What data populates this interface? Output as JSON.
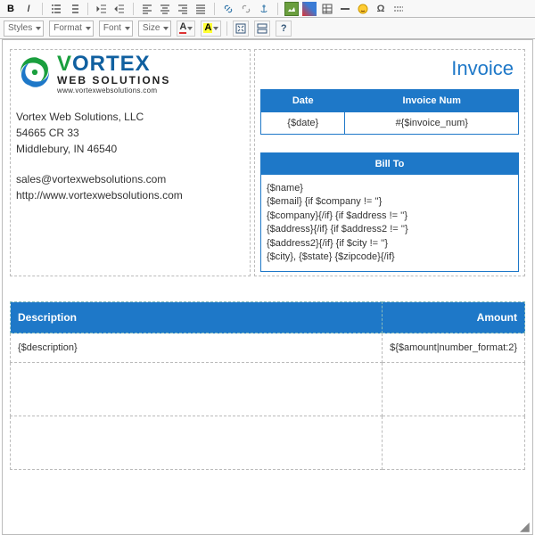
{
  "toolbar": {
    "styles_label": "Styles",
    "format_label": "Format",
    "font_label": "Font",
    "size_label": "Size"
  },
  "logo": {
    "brand_v": "V",
    "brand_rest": "ORTEX",
    "brand_sub": "WEB SOLUTIONS",
    "brand_url": "www.vortexwebsolutions.com"
  },
  "company": {
    "name": "Vortex Web Solutions, LLC",
    "addr1": "54665 CR 33",
    "addr2": "Middlebury, IN 46540",
    "email": "sales@vortexwebsolutions.com",
    "website": "http://www.vortexwebsolutions.com"
  },
  "invoice": {
    "title": "Invoice",
    "date_header": "Date",
    "num_header": "Invoice Num",
    "date_value": "{$date}",
    "num_value": "#{$invoice_num}"
  },
  "billto": {
    "header": "Bill To",
    "body": "{$name}\n{$email} {if $company != ''}\n{$company}{/if} {if $address != ''}\n{$address}{/if} {if $address2 != ''}\n{$address2}{/if} {if $city != ''}\n{$city}, {$state} {$zipcode}{/if}"
  },
  "lineitems": {
    "desc_header": "Description",
    "amount_header": "Amount",
    "desc_value": "{$description}",
    "amount_value": "${$amount|number_format:2}"
  }
}
